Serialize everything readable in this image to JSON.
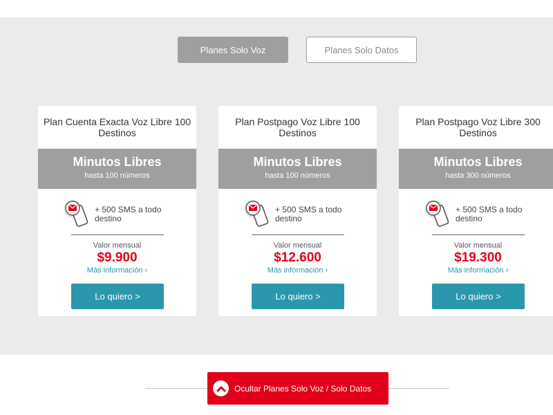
{
  "tabs": {
    "voice_only": "Planes Solo Voz",
    "data_only": "Planes Solo Datos"
  },
  "plans": [
    {
      "title": "Plan Cuenta Exacta Voz Libre 100 Destinos",
      "minutes_title": "Minutos Libres",
      "minutes_sub": "hasta 100 números",
      "sms": "+ 500 SMS a todo destino",
      "price_label": "Valor mensual",
      "price": "$9.900",
      "more_info": "Más información ›",
      "cta": "Lo quiero >"
    },
    {
      "title": "Plan Postpago Voz Libre 100 Destinos",
      "minutes_title": "Minutos Libres",
      "minutes_sub": "hasta 100 números",
      "sms": "+ 500 SMS a todo destino",
      "price_label": "Valor mensual",
      "price": "$12.600",
      "more_info": "Más información ›",
      "cta": "Lo quiero >"
    },
    {
      "title": "Plan Postpago Voz Libre 300 Destinos",
      "minutes_title": "Minutos Libres",
      "minutes_sub": "hasta 300 números",
      "sms": "+ 500 SMS a todo destino",
      "price_label": "Valor mensual",
      "price": "$19.300",
      "more_info": "Más información ›",
      "cta": "Lo quiero >"
    }
  ],
  "hide_button": "Ocultar Planes Solo Voz / Solo Datos",
  "icons": {
    "sms": "sms-phone-icon",
    "hide": "chevron-up-icon"
  },
  "colors": {
    "accent_red": "#e3001b",
    "button_teal": "#2a97ad",
    "link_blue": "#2596b0",
    "band_gray": "#9e9fa0"
  }
}
